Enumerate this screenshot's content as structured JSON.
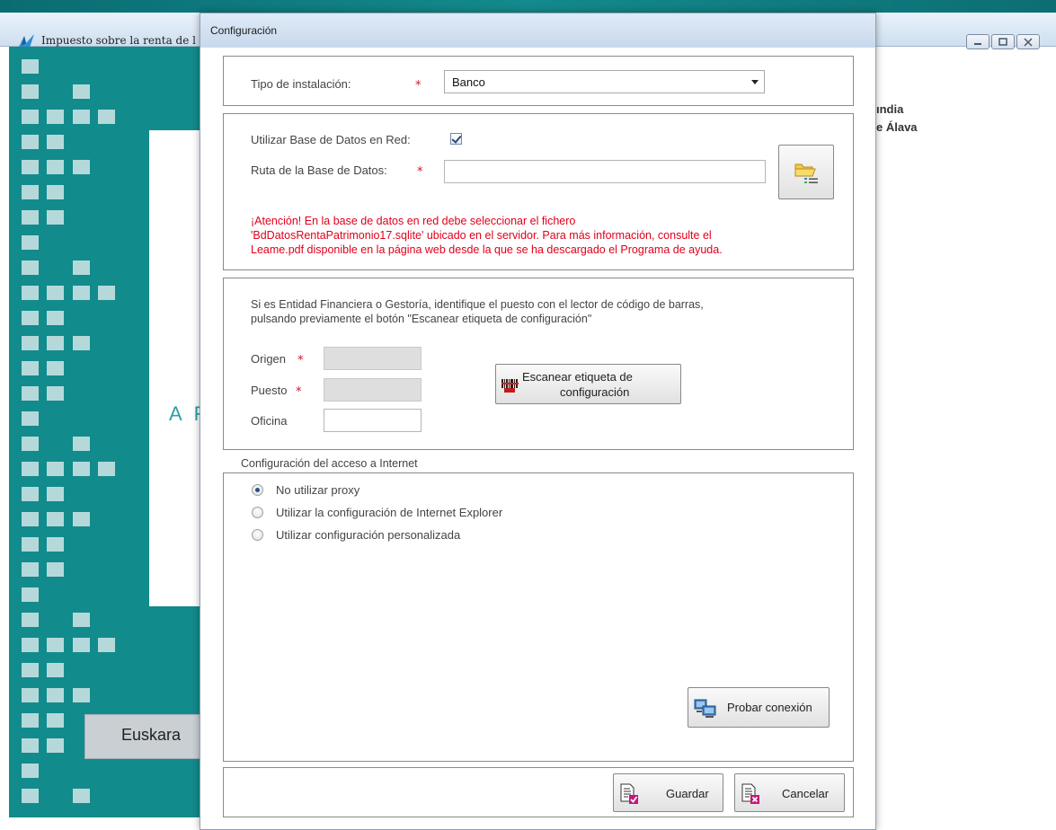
{
  "background_app": {
    "title": "Impuesto sobre la renta de l",
    "partial_text_1": "ındia",
    "partial_text_2": "e Álava",
    "partial_letter": "A F",
    "language_button": "Euskara"
  },
  "dialog": {
    "title": "Configuración",
    "installation": {
      "label": "Tipo de instalación:",
      "value": "Banco"
    },
    "database": {
      "network_db_label": "Utilizar Base de Datos en Red:",
      "network_db_checked": true,
      "path_label": "Ruta de la Base de Datos:",
      "path_value": "",
      "browse_icon": "folder-list-icon",
      "warning_line1": "¡Atención! En la base de datos en red debe seleccionar el fichero",
      "warning_line2": "'BdDatosRentaPatrimonio17.sqlite' ubicado en el servidor. Para más información, consulte el",
      "warning_line3": "Leame.pdf disponible en la página web desde la que se ha descargado el Programa de ayuda."
    },
    "entity": {
      "info_line1": "Si es Entidad Financiera o Gestoría, identifique el puesto con el lector de código de barras,",
      "info_line2": "pulsando previamente el botón \"Escanear etiqueta de configuración\"",
      "origen_label": "Origen",
      "puesto_label": "Puesto",
      "oficina_label": "Oficina",
      "scan_button_line1": "Escanear etiqueta de",
      "scan_button_line2": "configuración"
    },
    "internet": {
      "section_label": "Configuración del acceso a Internet",
      "options": [
        {
          "label": "No utilizar proxy",
          "selected": true
        },
        {
          "label": "Utilizar la configuración de Internet Explorer",
          "selected": false
        },
        {
          "label": "Utilizar configuración personalizada",
          "selected": false
        }
      ],
      "test_button": "Probar conexión"
    },
    "footer": {
      "save_button": "Guardar",
      "cancel_button": "Cancelar"
    },
    "required_mark": "*"
  },
  "colors": {
    "accent_teal": "#128b8c",
    "warning_red": "#e0001b",
    "required_red": "#d0102a"
  }
}
